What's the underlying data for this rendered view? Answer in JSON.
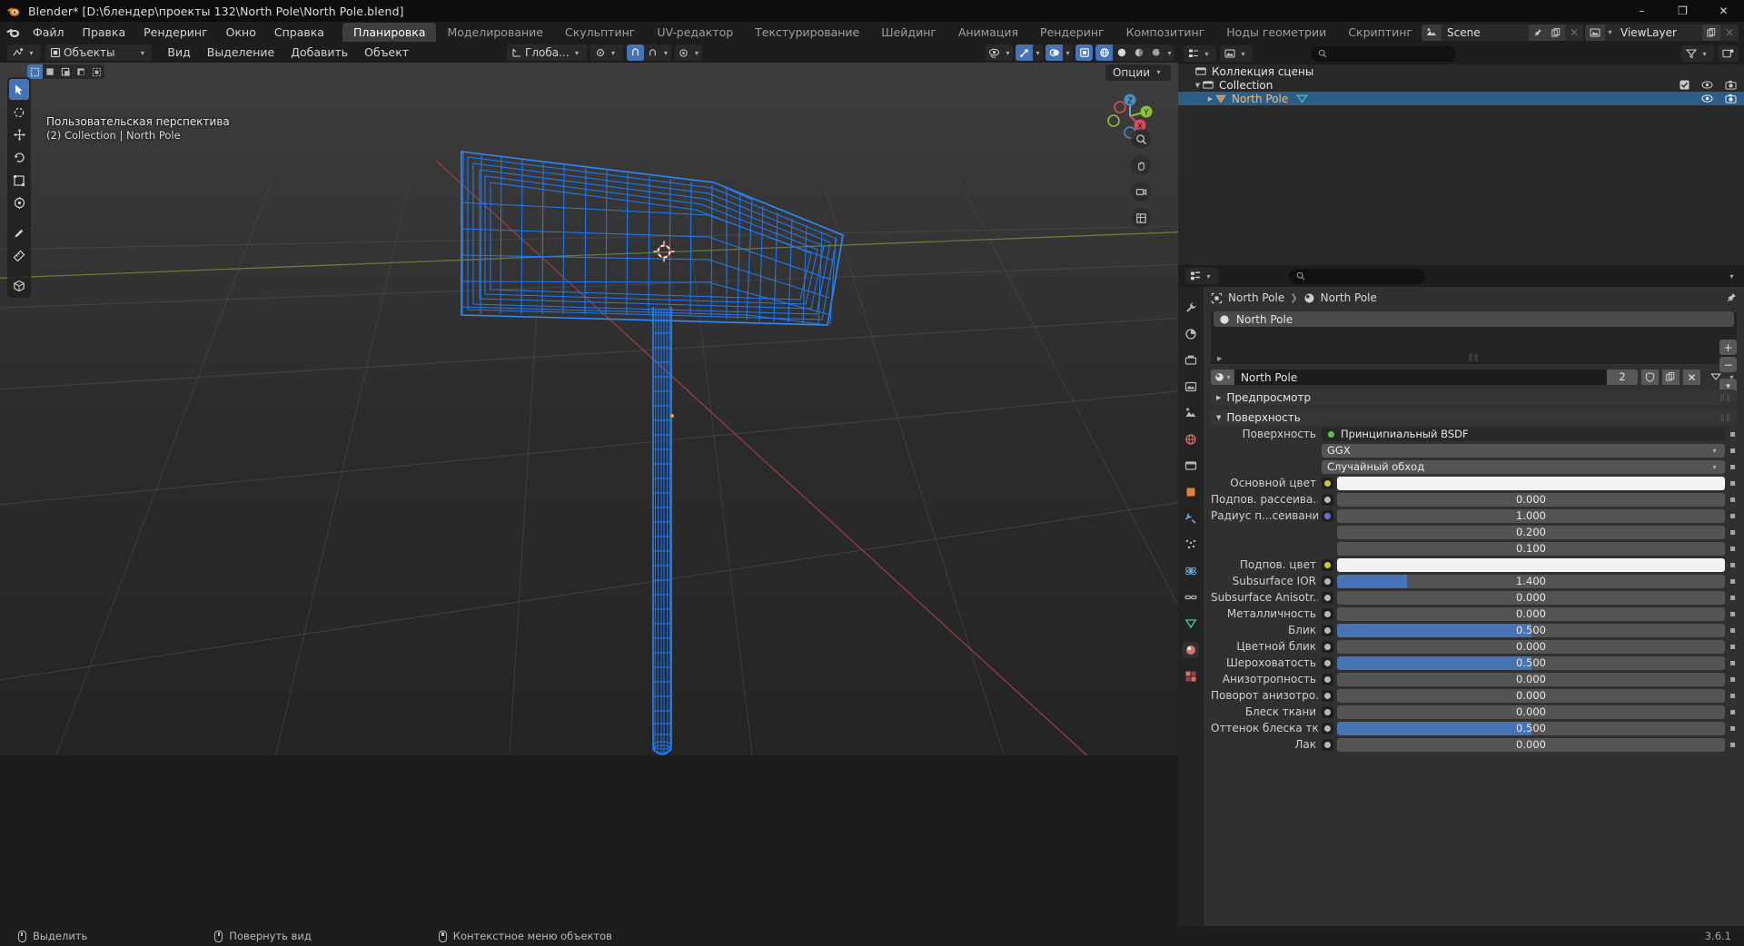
{
  "window": {
    "title": "Blender* [D:\\блендер\\проекты 132\\North Pole\\North Pole.blend]",
    "minimize": "–",
    "maximize": "❐",
    "close": "✕"
  },
  "menus": [
    "Файл",
    "Правка",
    "Рендеринг",
    "Окно",
    "Справка"
  ],
  "workspaces": {
    "tabs": [
      "Планировка",
      "Моделирование",
      "Скульптинг",
      "UV-редактор",
      "Текстурирование",
      "Шейдинг",
      "Анимация",
      "Рендеринг",
      "Композитинг",
      "Ноды геометрии",
      "Скриптинг"
    ],
    "active": "Планировка",
    "add_label": "+"
  },
  "scene_bar": {
    "scene_name": "Scene",
    "viewlayer_name": "ViewLayer"
  },
  "viewport": {
    "header": {
      "mode": "Объекты",
      "menus": [
        "Вид",
        "Выделение",
        "Добавить",
        "Объект"
      ],
      "transform_orientation": "Глоба...",
      "options_label": "Опции"
    },
    "overlay": {
      "perspective": "Пользовательская перспектива",
      "collection_line": "(2) Collection | North Pole"
    },
    "gizmo": {
      "x": "X",
      "y": "Y",
      "z": "Z"
    }
  },
  "outliner": {
    "search_placeholder": "",
    "rows": [
      {
        "label": "Коллекция сцены",
        "depth": 0,
        "icon": "collection-icon",
        "selected": false,
        "expandable": false,
        "checkbox": false,
        "eye": false,
        "camera": false
      },
      {
        "label": "Collection",
        "depth": 1,
        "icon": "collection-icon",
        "selected": false,
        "expandable": true,
        "checkbox": true,
        "eye": true,
        "camera": true
      },
      {
        "label": "North Pole",
        "depth": 2,
        "icon": "mesh-object-icon",
        "selected": true,
        "expandable": true,
        "checkbox": false,
        "eye": true,
        "camera": true
      }
    ]
  },
  "properties": {
    "search_placeholder": "",
    "breadcrumb": [
      "North Pole",
      "North Pole"
    ],
    "material_slot": "North Pole",
    "datablock": {
      "name": "North Pole",
      "users": "2"
    },
    "panels": {
      "preview": "Предпросмотр",
      "surface": "Поверхность"
    },
    "rows": [
      {
        "kind": "node",
        "label": "Поверхность",
        "value": "Принципиальный BSDF",
        "dot": "#5cc64b"
      },
      {
        "kind": "dropdown",
        "label": "",
        "value": "GGX"
      },
      {
        "kind": "dropdown",
        "label": "",
        "value": "Случайный обход"
      },
      {
        "kind": "color",
        "label": "Основной цвет",
        "value": "#f2f2f0",
        "socket": "#c8c83c"
      },
      {
        "kind": "slider",
        "label": "Подпов. рассеива...",
        "value": "0.000",
        "fill": 0,
        "socket": "#b8b8b8"
      },
      {
        "kind": "slider",
        "label": "Радиус п...сеивания",
        "value": "1.000",
        "fill": 0,
        "socket": "#6b6bd8"
      },
      {
        "kind": "slider",
        "label": "",
        "value": "0.200",
        "fill": 0,
        "socket": ""
      },
      {
        "kind": "slider",
        "label": "",
        "value": "0.100",
        "fill": 0,
        "socket": ""
      },
      {
        "kind": "color",
        "label": "Подпов. цвет",
        "value": "#f2f2f0",
        "socket": "#c8c83c"
      },
      {
        "kind": "slider",
        "label": "Subsurface IOR",
        "value": "1.400",
        "fill": 18,
        "socket": "#b8b8b8"
      },
      {
        "kind": "slider",
        "label": "Subsurface Anisotr...",
        "value": "0.000",
        "fill": 0,
        "socket": "#b8b8b8"
      },
      {
        "kind": "slider",
        "label": "Металличность",
        "value": "0.000",
        "fill": 0,
        "socket": "#b8b8b8"
      },
      {
        "kind": "slider",
        "label": "Блик",
        "value": "0.500",
        "fill": 50,
        "socket": "#b8b8b8"
      },
      {
        "kind": "slider",
        "label": "Цветной блик",
        "value": "0.000",
        "fill": 0,
        "socket": "#b8b8b8"
      },
      {
        "kind": "slider",
        "label": "Шероховатость",
        "value": "0.500",
        "fill": 50,
        "socket": "#b8b8b8"
      },
      {
        "kind": "slider",
        "label": "Анизотропность",
        "value": "0.000",
        "fill": 0,
        "socket": "#b8b8b8"
      },
      {
        "kind": "slider",
        "label": "Поворот анизотро...",
        "value": "0.000",
        "fill": 0,
        "socket": "#b8b8b8"
      },
      {
        "kind": "slider",
        "label": "Блеск ткани",
        "value": "0.000",
        "fill": 0,
        "socket": "#b8b8b8"
      },
      {
        "kind": "slider",
        "label": "Оттенок блеска тк...",
        "value": "0.500",
        "fill": 50,
        "socket": "#b8b8b8"
      },
      {
        "kind": "slider",
        "label": "Лак",
        "value": "0.000",
        "fill": 0,
        "socket": "#b8b8b8"
      }
    ]
  },
  "status_bar": {
    "items": [
      "Выделить",
      "Повернуть вид",
      "Контекстное меню объектов"
    ],
    "version": "3.6.1"
  },
  "colors": {
    "accent": "#4772b3",
    "selection": "#2c5d87",
    "wire_selected": "#1e7bff",
    "axis_x": "#9e4b52",
    "axis_y": "#7a8a3f"
  }
}
